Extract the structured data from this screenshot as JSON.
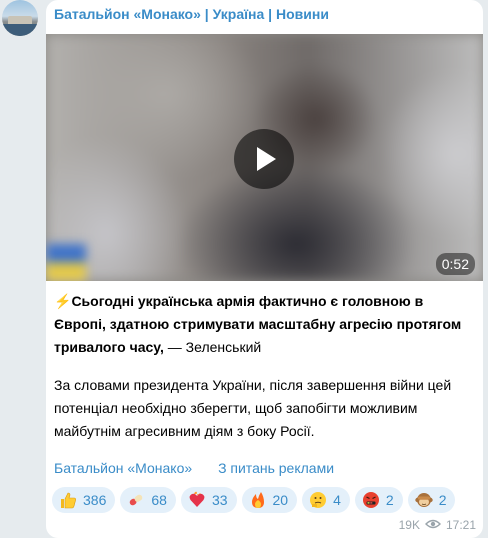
{
  "channel": {
    "title": "Батальйон «Монако» | Україна | Новини"
  },
  "video": {
    "duration": "0:52"
  },
  "post": {
    "emoji_prefix": "⚡",
    "headline_bold": "Сьогодні українська армія фактично є головною в Європі, здатною стримувати масштабну агресію протягом тривалого часу,",
    "headline_attribution": " — Зеленський",
    "body": "За словами президента України, після завершення війни цей потенціал необхідно зберегти, щоб запобігти можливим майбутнім агресивним діям з боку Росії."
  },
  "links": {
    "channel_link": "Батальйон «Монако»",
    "ads_link": "З питань реклами"
  },
  "reactions": [
    {
      "icon": "thumbs-up-icon",
      "count": "386"
    },
    {
      "icon": "pill-icon",
      "count": "68"
    },
    {
      "icon": "heart-on-fire-icon",
      "count": "33"
    },
    {
      "icon": "fire-icon",
      "count": "20"
    },
    {
      "icon": "thinking-face-icon",
      "count": "4"
    },
    {
      "icon": "cursing-face-icon",
      "count": "2"
    },
    {
      "icon": "see-no-evil-monkey-icon",
      "count": "2"
    }
  ],
  "meta": {
    "views": "19K",
    "time": "17:21"
  },
  "colors": {
    "accent": "#3a8cc8",
    "reaction_bg": "#e4f0fa",
    "chat_bg": "#e6ebee"
  }
}
